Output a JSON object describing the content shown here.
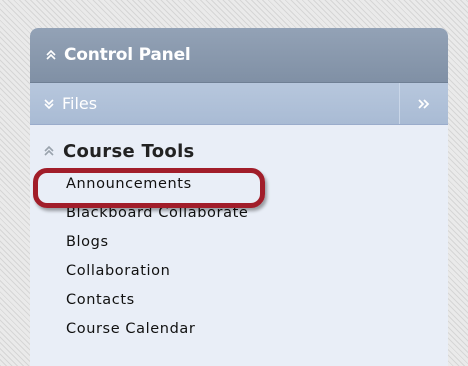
{
  "control_panel": {
    "title": "Control Panel"
  },
  "files": {
    "label": "Files"
  },
  "course_tools": {
    "title": "Course Tools",
    "items": [
      {
        "label": "Announcements",
        "highlighted": true
      },
      {
        "label": "Blackboard Collaborate"
      },
      {
        "label": "Blogs"
      },
      {
        "label": "Collaboration"
      },
      {
        "label": "Contacts"
      },
      {
        "label": "Course Calendar"
      }
    ]
  },
  "colors": {
    "header_bg": "#8a99ad",
    "files_bg": "#b0c1d8",
    "panel_bg": "#e9eef7",
    "highlight_ring": "#a11d2a"
  }
}
